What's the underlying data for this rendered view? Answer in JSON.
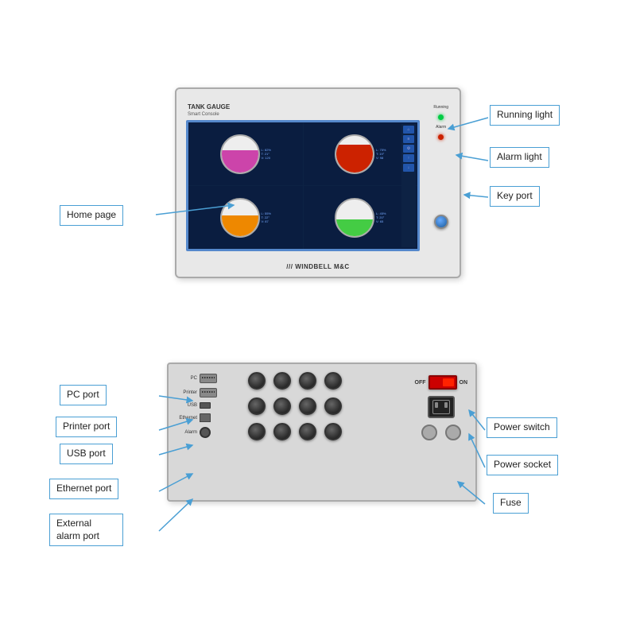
{
  "labels": {
    "running_light": "Running light",
    "alarm_light": "Alarm light",
    "key_port": "Key port",
    "home_page": "Home page",
    "pc_port": "PC port",
    "printer_port": "Printer port",
    "usb_port": "USB port",
    "ethernet_port": "Ethernet port",
    "external_alarm_port": "External alarm\nport",
    "power_switch": "Power switch",
    "power_socket": "Power socket",
    "fuse": "Fuse"
  },
  "device": {
    "brand": "TANK GAUGE",
    "subtitle": "Smart Console",
    "logo": "/// WINDBELL M&C",
    "indicator_running": "Running",
    "indicator_alarm": "Alarm"
  },
  "back_panel": {
    "pc_label": "PC",
    "printer_label": "Printer",
    "usb_label": "USB",
    "ethernet_label": "Ethernet",
    "alarm_label": "Alarm",
    "off_label": "OFF",
    "on_label": "ON"
  },
  "colors": {
    "arrow": "#4a9fd4",
    "label_border": "#4a9fd4",
    "dot_green": "#00cc44",
    "dot_red": "#cc2200",
    "tank1_fill": "#cc44aa",
    "tank2_fill": "#cc2200",
    "tank3_fill": "#ee8800",
    "tank4_fill": "#44cc44"
  }
}
